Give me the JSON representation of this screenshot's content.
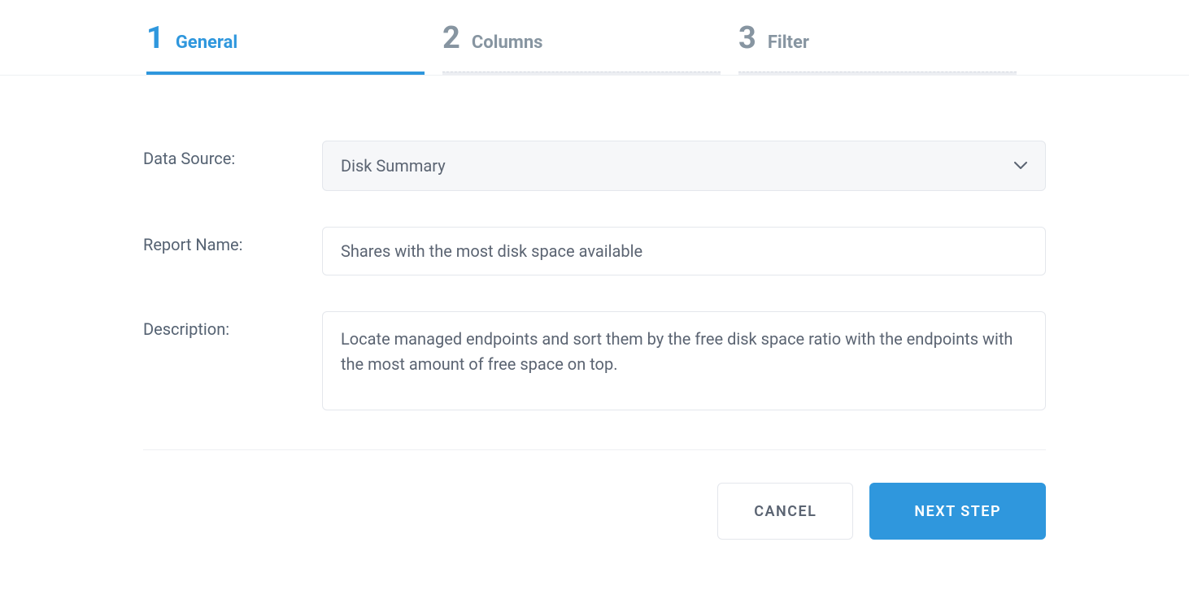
{
  "stepper": {
    "active_index": 0,
    "steps": [
      {
        "number": "1",
        "label": "General"
      },
      {
        "number": "2",
        "label": "Columns"
      },
      {
        "number": "3",
        "label": "Filter"
      }
    ]
  },
  "form": {
    "data_source": {
      "label": "Data Source:",
      "value": "Disk Summary"
    },
    "report_name": {
      "label": "Report Name:",
      "value": "Shares with the most disk space available"
    },
    "description": {
      "label": "Description:",
      "value": "Locate managed endpoints and sort them by the free disk space ratio with the endpoints with the most amount of free space on top."
    }
  },
  "buttons": {
    "cancel": "CANCEL",
    "next": "NEXT STEP"
  }
}
